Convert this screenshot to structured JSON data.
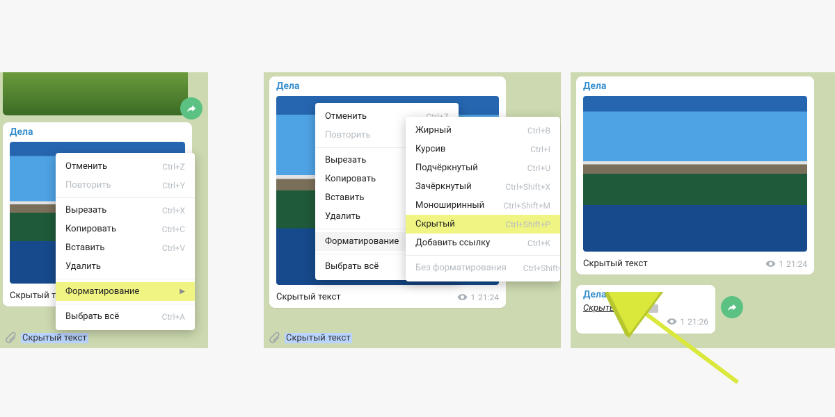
{
  "chat_name": "Дела",
  "caption_full": "Скрытый текст",
  "spoiler_prefix": "Скрытый",
  "time1": "21:24",
  "time2": "21:24",
  "time3a": "21:24",
  "time3b": "21:26",
  "views_count": "1",
  "menu_short": {
    "undo": "Отменить",
    "undo_sc": "Ctrl+Z",
    "redo": "Повторить",
    "redo_sc": "Ctrl+Y",
    "cut": "Вырезать",
    "cut_sc": "Ctrl+X",
    "copy": "Копировать",
    "copy_sc": "Ctrl+C",
    "paste": "Вставить",
    "paste_sc": "Ctrl+V",
    "delete": "Удалить",
    "formatting": "Форматирование",
    "select_all": "Выбрать всё",
    "select_all_sc": "Ctrl+A"
  },
  "submenu": {
    "bold": "Жирный",
    "bold_sc": "Ctrl+B",
    "italic": "Курсив",
    "italic_sc": "Ctrl+I",
    "underline": "Подчёркнутый",
    "underline_sc": "Ctrl+U",
    "strike": "Зачёркнутый",
    "strike_sc": "Ctrl+Shift+X",
    "mono": "Моноширинный",
    "mono_sc": "Ctrl+Shift+M",
    "spoiler": "Скрытый",
    "spoiler_sc": "Ctrl+Shift+P",
    "link": "Добавить ссылку",
    "link_sc": "Ctrl+K",
    "clear": "Без форматирования",
    "clear_sc": "Ctrl+Shift+N"
  }
}
